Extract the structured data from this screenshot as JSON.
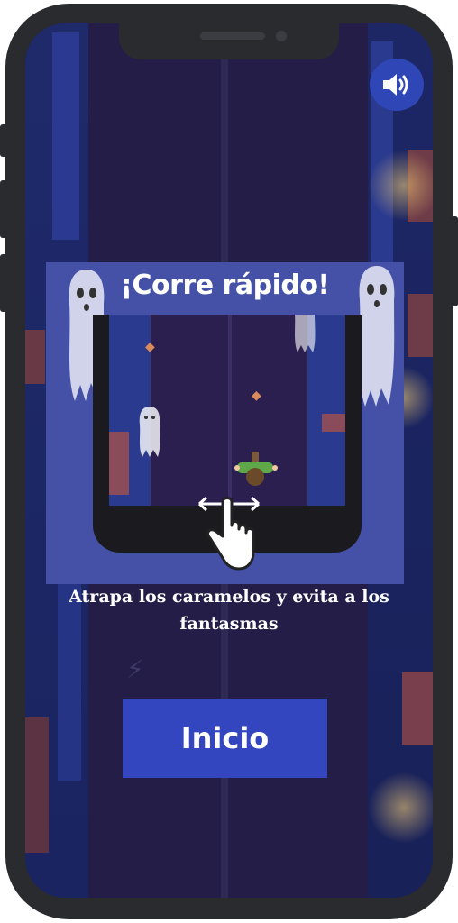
{
  "game": {
    "title": "¡Corre rápido!",
    "instructions": "Atrapa los caramelos y evita a los fantasmas",
    "start_label": "Inicio"
  },
  "icons": {
    "sound": "speaker-volume-icon",
    "swipe": "swipe-hand-icon",
    "ghost": "ghost-icon",
    "candy": "candy-icon",
    "player": "child-runner-icon"
  },
  "colors": {
    "card": "#4451a6",
    "button": "#3446bf",
    "street": "#231d48"
  }
}
